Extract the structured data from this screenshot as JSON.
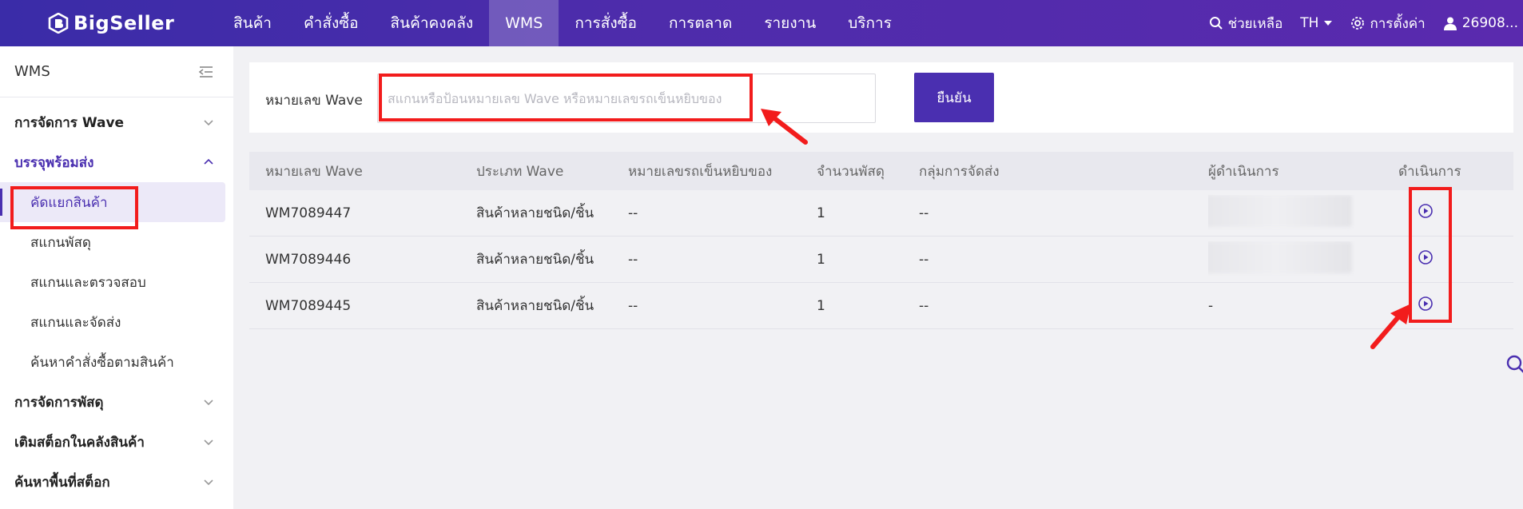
{
  "app": {
    "name": "BigSeller"
  },
  "nav": {
    "items": [
      {
        "label": "สินค้า",
        "active": false
      },
      {
        "label": "คำสั่งซื้อ",
        "active": false
      },
      {
        "label": "สินค้าคงคลัง",
        "active": false
      },
      {
        "label": "WMS",
        "active": true
      },
      {
        "label": "การสั่งซื้อ",
        "active": false
      },
      {
        "label": "การตลาด",
        "active": false
      },
      {
        "label": "รายงาน",
        "active": false
      },
      {
        "label": "บริการ",
        "active": false
      }
    ]
  },
  "topright": {
    "help": "ช่วยเหลือ",
    "lang": "TH",
    "settings": "การตั้งค่า",
    "user": "26908..."
  },
  "sidebar": {
    "title": "WMS",
    "groups": [
      {
        "label": "การจัดการ Wave"
      },
      {
        "label": "บรรจุพร้อมส่ง",
        "children": [
          "คัดแยกสินค้า",
          "สแกนพัสดุ",
          "สแกนและตรวจสอบ",
          "สแกนและจัดส่ง",
          "ค้นหาคำสั่งซื้อตามสินค้า"
        ]
      },
      {
        "label": "การจัดการพัสดุ"
      },
      {
        "label": "เติมสต็อกในคลังสินค้า"
      },
      {
        "label": "ค้นหาพื้นที่สต็อก"
      }
    ]
  },
  "search": {
    "label": "หมายเลข Wave",
    "placeholder": "สแกนหรือป้อนหมายเลข Wave หรือหมายเลขรถเข็นหยิบของ",
    "confirm": "ยืนยัน"
  },
  "table": {
    "headers": [
      "หมายเลข Wave",
      "ประเภท Wave",
      "หมายเลขรถเข็นหยิบของ",
      "จำนวนพัสดุ",
      "กลุ่มการจัดส่ง",
      "ผู้ดำเนินการ",
      "ดำเนินการ"
    ],
    "rows": [
      {
        "wave": "WM7089447",
        "type": "สินค้าหลายชนิด/ชิ้น",
        "cart": "--",
        "count": "1",
        "group": "--",
        "operator": ""
      },
      {
        "wave": "WM7089446",
        "type": "สินค้าหลายชนิด/ชิ้น",
        "cart": "--",
        "count": "1",
        "group": "--",
        "operator": ""
      },
      {
        "wave": "WM7089445",
        "type": "สินค้าหลายชนิด/ชิ้น",
        "cart": "--",
        "count": "1",
        "group": "--",
        "operator": "-"
      }
    ]
  },
  "colors": {
    "primary": "#4a2fb0",
    "nav_bg": "#4b2ba6",
    "annotation": "#f21c1c"
  }
}
